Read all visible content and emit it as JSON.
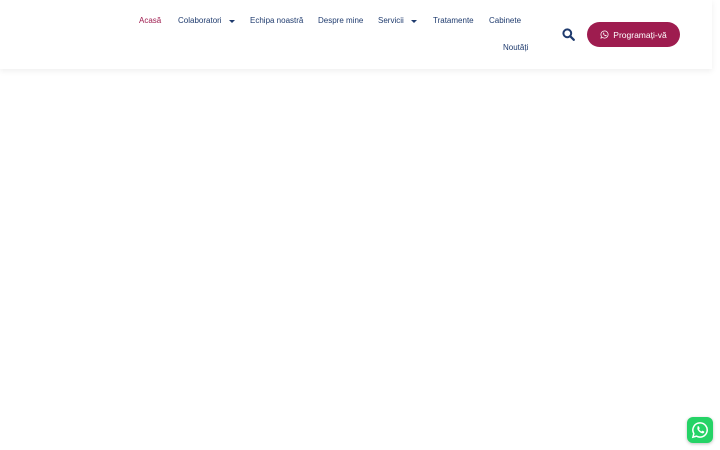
{
  "nav": {
    "items": [
      {
        "label": "Acasă",
        "active": true
      },
      {
        "label": "Colaboratori",
        "dropdown": true
      },
      {
        "label": "Echipa noastră"
      },
      {
        "label": "Despre mine"
      },
      {
        "label": "Servicii",
        "dropdown": true
      },
      {
        "label": "Tratamente"
      },
      {
        "label": "Cabinete"
      },
      {
        "label": "Noutăți"
      }
    ]
  },
  "search": {
    "icon": "search-icon"
  },
  "cta": {
    "label": "Programați-vă",
    "icon": "whatsapp-icon",
    "color": "#9e1c4f"
  },
  "floating_button": {
    "icon": "whatsapp-icon",
    "color": "#25d366"
  },
  "colors": {
    "nav_text": "#1f3b6e",
    "active": "#9e1c4f"
  }
}
